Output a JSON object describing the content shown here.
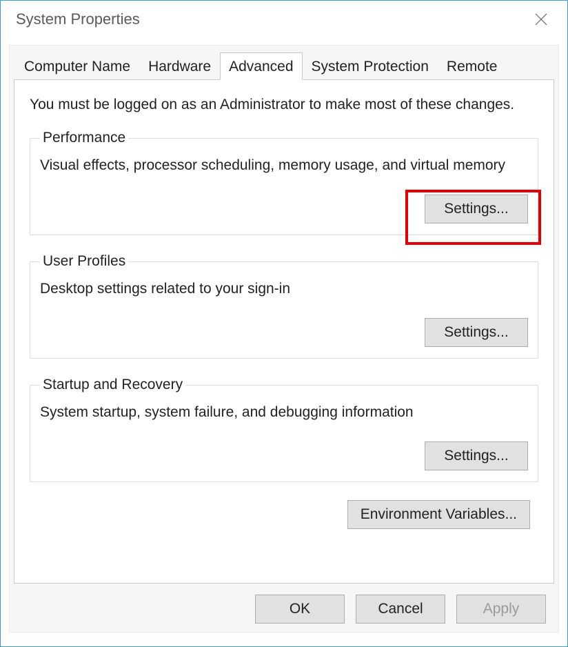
{
  "window": {
    "title": "System Properties"
  },
  "tabs": {
    "computer_name": "Computer Name",
    "hardware": "Hardware",
    "advanced": "Advanced",
    "system_protection": "System Protection",
    "remote": "Remote",
    "active": "advanced"
  },
  "admin_note": "You must be logged on as an Administrator to make most of these changes.",
  "performance": {
    "legend": "Performance",
    "desc": "Visual effects, processor scheduling, memory usage, and virtual memory",
    "button": "Settings..."
  },
  "user_profiles": {
    "legend": "User Profiles",
    "desc": "Desktop settings related to your sign-in",
    "button": "Settings..."
  },
  "startup_recovery": {
    "legend": "Startup and Recovery",
    "desc": "System startup, system failure, and debugging information",
    "button": "Settings..."
  },
  "env_variables_button": "Environment Variables...",
  "footer": {
    "ok": "OK",
    "cancel": "Cancel",
    "apply": "Apply"
  }
}
